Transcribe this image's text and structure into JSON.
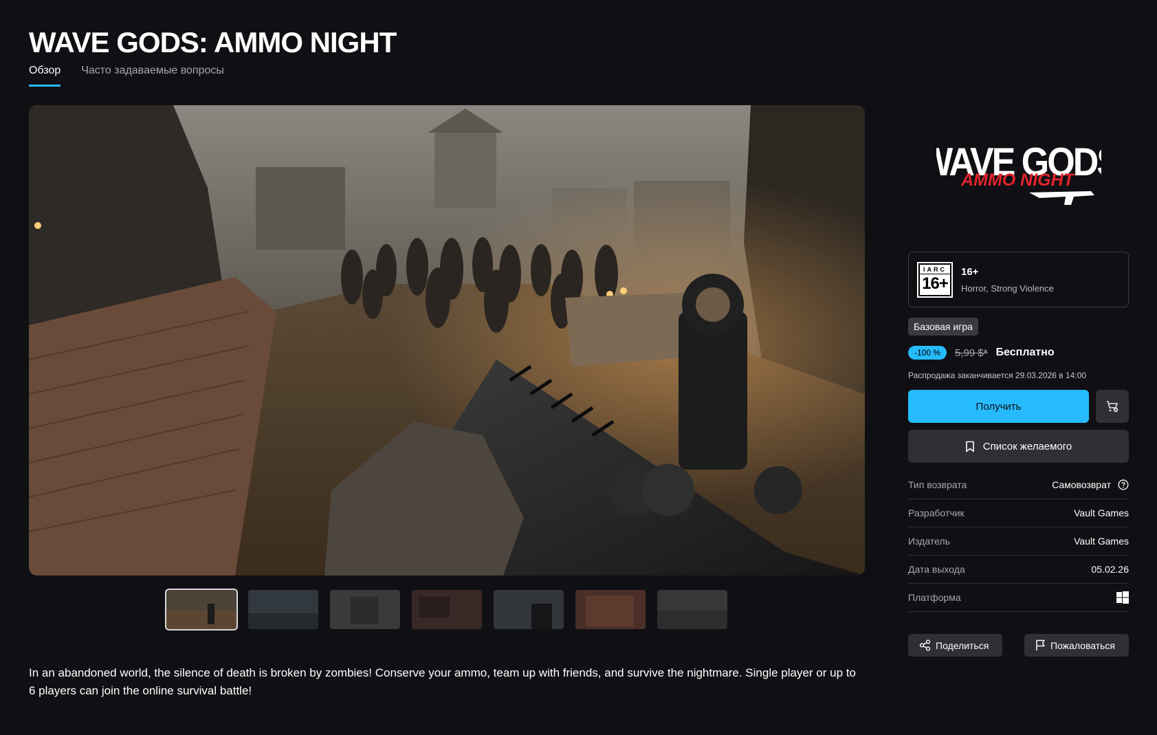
{
  "game": {
    "title": "WAVE GODS: AMMO NIGHT",
    "logo_line1": "WAVE GODS",
    "logo_line2": "AMMO NIGHT"
  },
  "tabs": [
    {
      "label": "Обзор",
      "active": true
    },
    {
      "label": "Часто задаваемые вопросы",
      "active": false
    }
  ],
  "media": {
    "thumbnail_count": 7,
    "active_thumbnail": 0
  },
  "description": "In an abandoned world, the silence of death is broken by zombies! Conserve your ammo, team up with friends, and survive the nightmare. Single player or up to 6 players can join the online survival battle!",
  "rating": {
    "badge_top": "IARC",
    "badge_age": "16+",
    "age": "16+",
    "descriptors": "Horror, Strong Violence"
  },
  "purchase": {
    "edition_badge": "Базовая игра",
    "discount": "-100 %",
    "original_price": "5,99 $*",
    "current_price": "Бесплатно",
    "sale_ends": "Распродажа заканчивается 29.03.2026 в 14:00",
    "get_label": "Получить",
    "wishlist_label": "Список желаемого"
  },
  "details": {
    "refund_label": "Тип возврата",
    "refund_value": "Самовозврат",
    "developer_label": "Разработчик",
    "developer_value": "Vault Games",
    "publisher_label": "Издатель",
    "publisher_value": "Vault Games",
    "release_label": "Дата выхода",
    "release_value": "05.02.26",
    "platform_label": "Платформа",
    "platform_icon": "windows-icon"
  },
  "actions": {
    "share_label": "Поделиться",
    "report_label": "Пожаловаться"
  },
  "colors": {
    "accent": "#26bbff",
    "background": "#101014",
    "button": "#2f2f35",
    "logo_red": "#e0242b"
  }
}
